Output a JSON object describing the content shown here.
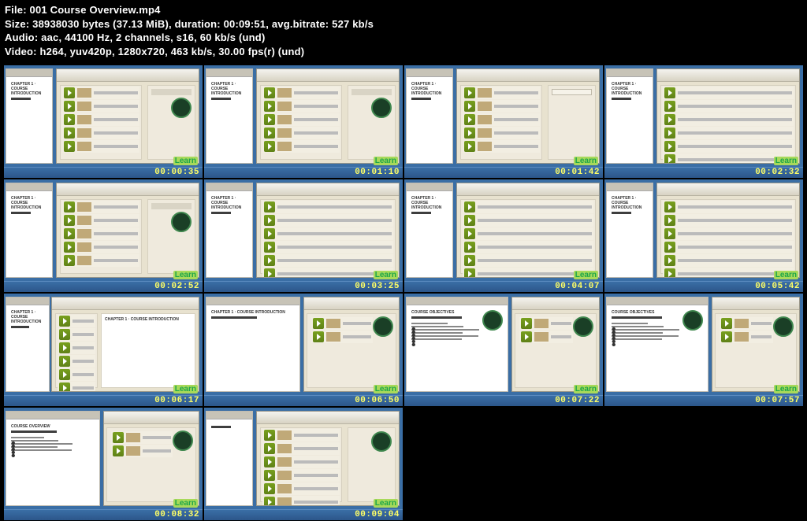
{
  "meta": {
    "file_label": "File:",
    "file": "001 Course Overview.mp4",
    "size_label": "Size:",
    "size_bytes": "38938030 bytes (37.13 MiB)",
    "duration_label": "duration:",
    "duration": "00:09:51",
    "avgbr_label": "avg.bitrate:",
    "avgbr": "527 kb/s",
    "audio_label": "Audio:",
    "audio": "aac, 44100 Hz, 2 channels, s16, 60 kb/s (und)",
    "video_label": "Video:",
    "video": "h264, yuv420p, 1280x720, 463 kb/s, 30.00 fps(r) (und)"
  },
  "logo_text": "Learn",
  "doc_title_intro": "CHAPTER 1 · COURSE INTRODUCTION",
  "doc_title_obj": "COURSE OBJECTIVES",
  "doc_title_over": "COURSE OVERVIEW",
  "thumbnails": [
    {
      "ts": "00:00:35",
      "type": "browser_doc"
    },
    {
      "ts": "00:01:10",
      "type": "browser_doc"
    },
    {
      "ts": "00:01:42",
      "type": "browser_popup"
    },
    {
      "ts": "00:02:32",
      "type": "browser_list"
    },
    {
      "ts": "00:02:52",
      "type": "browser_doc"
    },
    {
      "ts": "00:03:25",
      "type": "browser_list"
    },
    {
      "ts": "00:04:07",
      "type": "browser_list"
    },
    {
      "ts": "00:05:42",
      "type": "browser_list"
    },
    {
      "ts": "00:06:17",
      "type": "browser_doc_side"
    },
    {
      "ts": "00:06:50",
      "type": "doc_browser_side"
    },
    {
      "ts": "00:07:22",
      "type": "doc_obj_browser"
    },
    {
      "ts": "00:07:57",
      "type": "doc_obj_browser"
    },
    {
      "ts": "00:08:32",
      "type": "doc_over_browser"
    },
    {
      "ts": "00:09:04",
      "type": "doc_browser"
    }
  ]
}
